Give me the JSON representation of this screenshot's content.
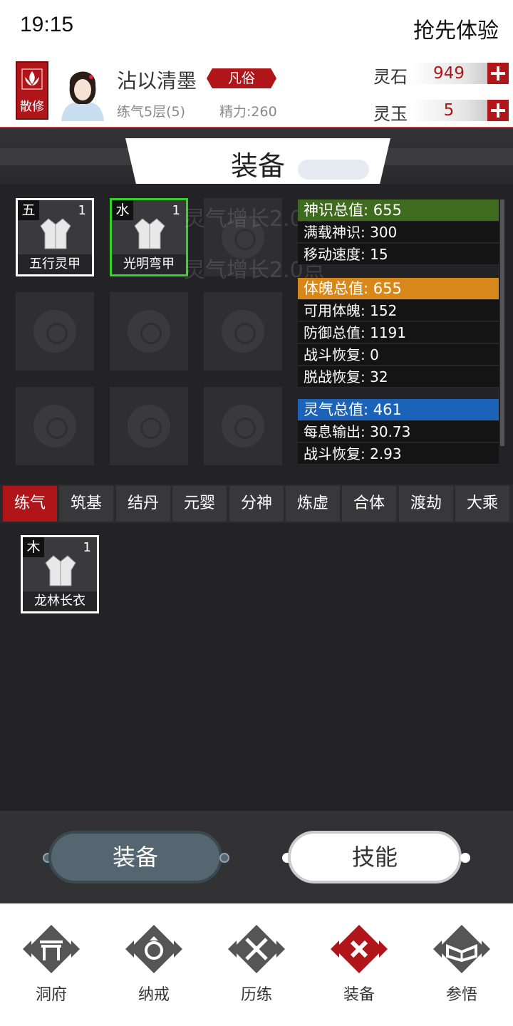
{
  "status": {
    "time": "19:15",
    "early_access": "抢先体验"
  },
  "player": {
    "sect": "散修",
    "name": "沾以清墨",
    "rank": "凡俗",
    "realm": "练气5层(5)",
    "energy": "精力:260"
  },
  "currency": [
    {
      "label": "灵石",
      "value": "949"
    },
    {
      "label": "灵玉",
      "value": "5"
    }
  ],
  "section_title": "装备",
  "watermark": "灵气增长2.0点",
  "equipped": [
    {
      "element": "五",
      "level": "1",
      "name": "五行灵甲",
      "border": "#ffffff"
    },
    {
      "element": "水",
      "level": "1",
      "name": "光明弯甲",
      "border": "#37d12e"
    }
  ],
  "stats": {
    "spirit_sense": {
      "header": "神识总值: 655",
      "color": "#3f6b1f",
      "rows": [
        "满载神识: 300",
        "移动速度: 15"
      ]
    },
    "physique": {
      "header": "体魄总值: 655",
      "color": "#d8881a",
      "rows": [
        "可用体魄: 152",
        "防御总值: 1191",
        "战斗恢复: 0",
        "脱战恢复: 32"
      ]
    },
    "qi": {
      "header": "灵气总值: 461",
      "color": "#1a63b8",
      "rows": [
        "每息输出: 30.73",
        "战斗恢复: 2.93"
      ]
    }
  },
  "realm_tabs": [
    "练气",
    "筑基",
    "结丹",
    "元婴",
    "分神",
    "炼虚",
    "合体",
    "渡劫",
    "大乘"
  ],
  "active_realm_tab": "练气",
  "inventory": [
    {
      "element": "木",
      "level": "1",
      "name": "龙林长衣"
    }
  ],
  "actions": {
    "equip": "装备",
    "skill": "技能"
  },
  "nav": [
    {
      "label": "洞府",
      "icon": "cave-gate-icon"
    },
    {
      "label": "纳戒",
      "icon": "ring-icon"
    },
    {
      "label": "历练",
      "icon": "crossed-swords-icon"
    },
    {
      "label": "装备",
      "icon": "equipment-icon",
      "active": true
    },
    {
      "label": "参悟",
      "icon": "open-book-icon"
    }
  ],
  "colors": {
    "accent_red": "#b0151a",
    "equip_button": "#566670"
  }
}
